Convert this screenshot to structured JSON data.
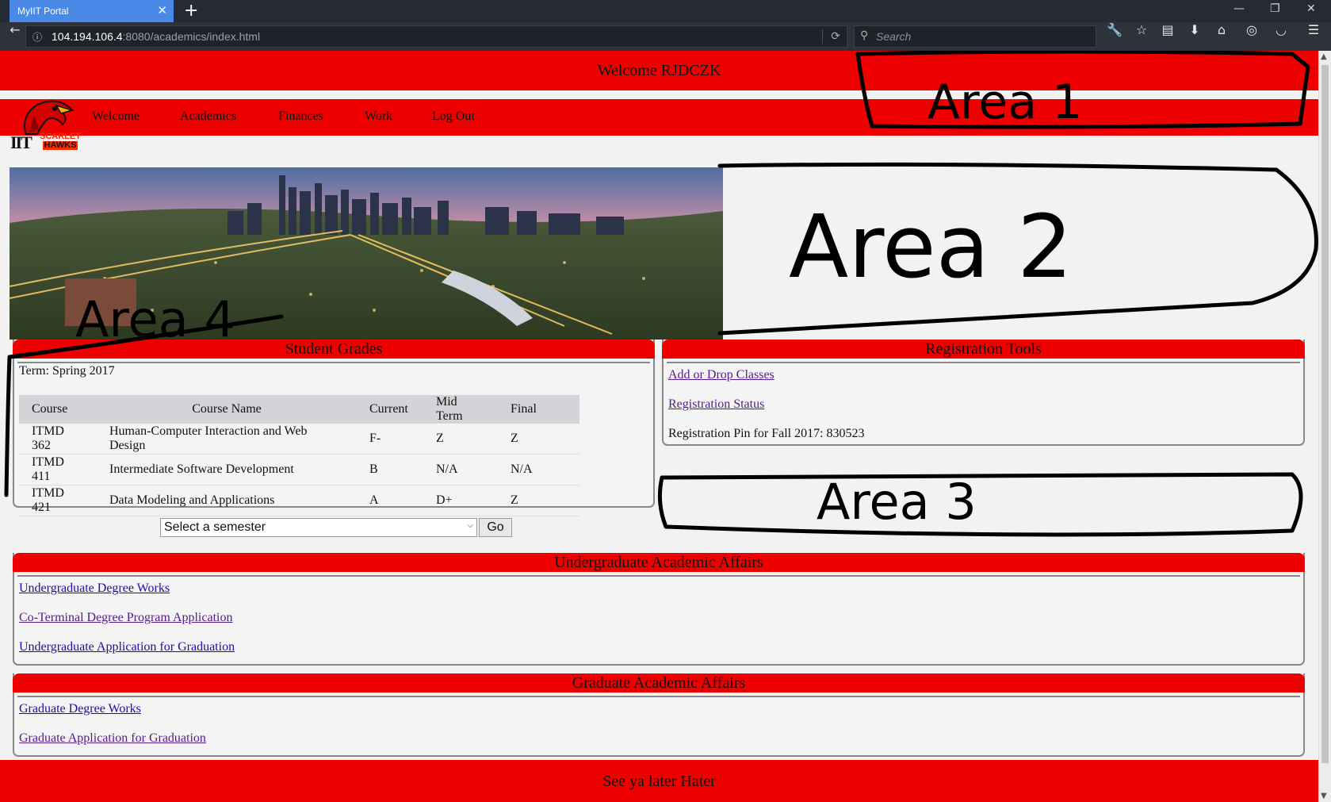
{
  "browser": {
    "tab_title": "MyIIT Portal",
    "tab_close": "✕",
    "new_tab": "+",
    "url_host": "104.194.106.4",
    "url_rest": ":8080/academics/index.html",
    "search_placeholder": "Search"
  },
  "header": {
    "welcome_text": "Welcome RJDCZK"
  },
  "logo": {
    "word1": "SCARLET",
    "word2": "HAWKS",
    "iit": "IIT"
  },
  "nav": {
    "items": [
      {
        "label": "Welcome"
      },
      {
        "label": "Academics"
      },
      {
        "label": "Finances"
      },
      {
        "label": "Work"
      },
      {
        "label": "Log Out"
      }
    ]
  },
  "student_grades": {
    "title": "Student Grades",
    "term": "Term: Spring 2017",
    "columns": [
      "Course",
      "Course Name",
      "Current",
      "Mid Term",
      "Final"
    ],
    "rows": [
      [
        "ITMD 362",
        "Human-Computer Interaction and Web Design",
        "F-",
        "Z",
        "Z"
      ],
      [
        "ITMD 411",
        "Intermediate Software Development",
        "B",
        "N/A",
        "N/A"
      ],
      [
        "ITMD 421",
        "Data Modeling and Applications",
        "A",
        "D+",
        "Z"
      ]
    ],
    "semester_select": "Select a semester",
    "go_label": "Go"
  },
  "registration_tools": {
    "title": "Registration Tools",
    "links": [
      "Add or Drop Classes",
      "Registration Status"
    ],
    "pin_text": "Registration Pin for Fall 2017: 830523"
  },
  "undergrad_affairs": {
    "title": "Undergraduate Academic Affairs",
    "links": [
      "Undergraduate Degree Works",
      "Co-Terminal Degree Program Application",
      "Undergraduate Application for Graduation"
    ]
  },
  "grad_affairs": {
    "title": "Graduate Academic Affairs",
    "links": [
      "Graduate Degree Works",
      "Graduate Application for Graduation"
    ]
  },
  "footer": {
    "text": "See ya later Hater"
  },
  "annotations": {
    "area1": "Area 1",
    "area2": "Area 2",
    "area3": "Area 3",
    "area4": "Area 4"
  },
  "colors": {
    "brand_red": "#ee0000",
    "tab_blue": "#4a8ae6",
    "chrome_dark": "#252a33"
  }
}
